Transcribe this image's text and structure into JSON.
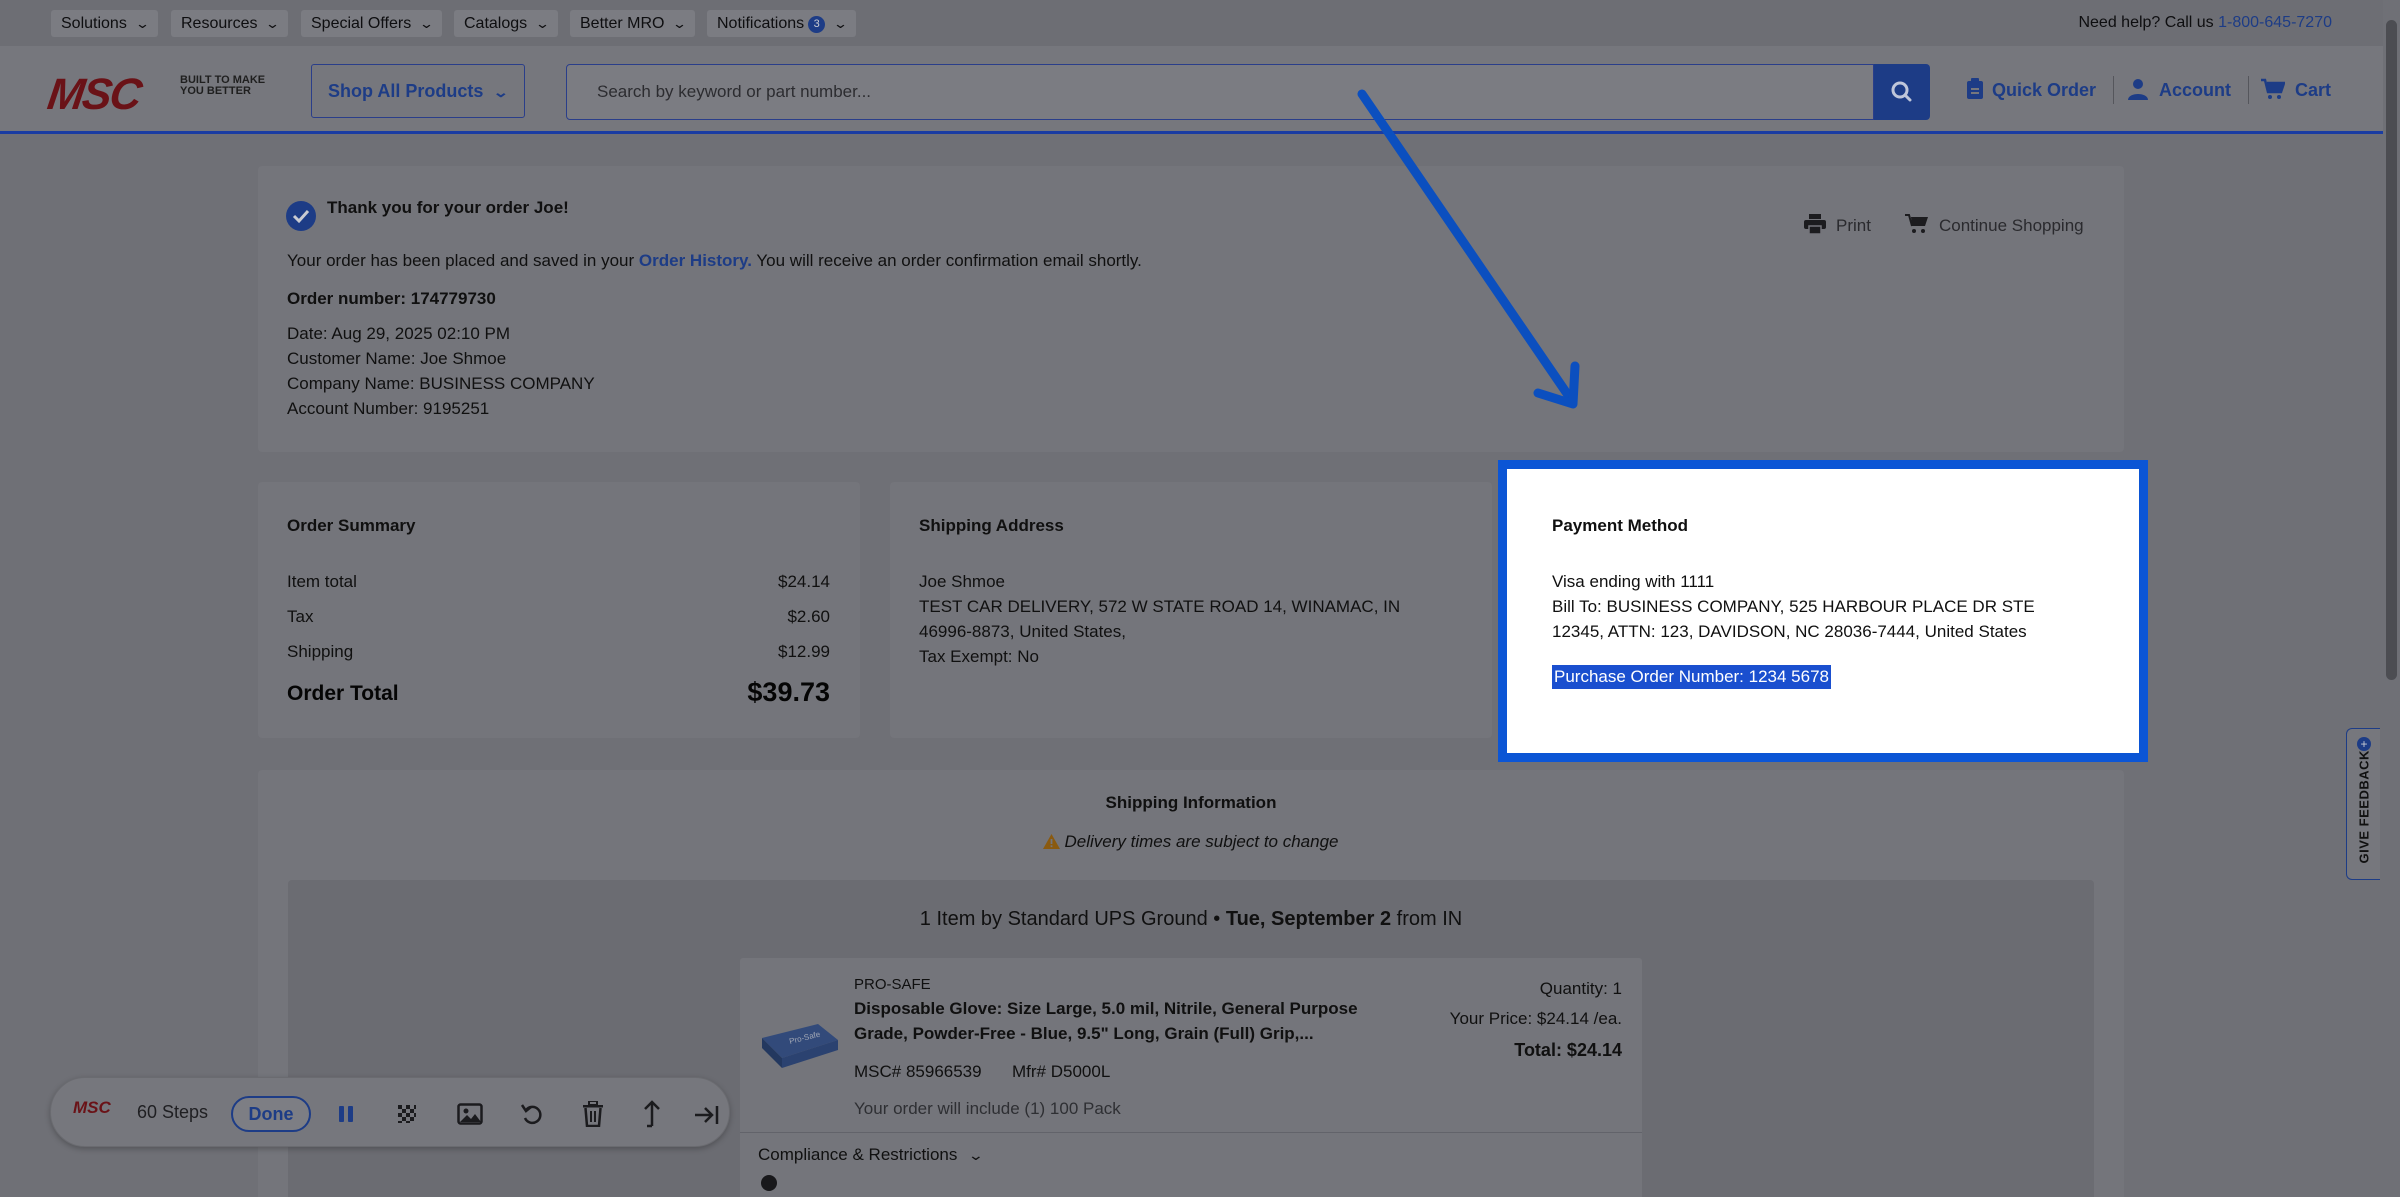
{
  "utility_nav": {
    "items": [
      {
        "label": "Solutions"
      },
      {
        "label": "Resources"
      },
      {
        "label": "Special Offers"
      },
      {
        "label": "Catalogs"
      },
      {
        "label": "Better MRO"
      },
      {
        "label": "Notifications",
        "badge": "3"
      }
    ],
    "help_text": "Need help? Call us",
    "help_phone": "1-800-645-7270"
  },
  "header": {
    "logo": "MSC",
    "logo_tagline": "BUILT TO MAKE YOU BETTER",
    "shop_all_label": "Shop All Products",
    "search_placeholder": "Search by keyword or part number...",
    "quick_order_label": "Quick Order",
    "account_label": "Account",
    "cart_label": "Cart",
    "brand_color": "#1d3c86"
  },
  "confirmation": {
    "title": "Thank you for your order Joe!",
    "message_before": "Your order has been placed and saved in your",
    "order_history_link": "Order History.",
    "message_after": "You will receive an order confirmation email shortly.",
    "order_number": "Order number: 174779730",
    "date": "Date: Aug 29, 2025 02:10 PM",
    "customer_name": "Customer Name: Joe Shmoe",
    "company_name": "Company Name: BUSINESS COMPANY",
    "account_number": "Account Number: 9195251",
    "print_label": "Print",
    "continue_label": "Continue Shopping"
  },
  "order_summary": {
    "title": "Order Summary",
    "lines": [
      {
        "label": "Item total",
        "value": "$24.14"
      },
      {
        "label": "Tax",
        "value": "$2.60"
      },
      {
        "label": "Shipping",
        "value": "$12.99"
      }
    ],
    "total_label": "Order Total",
    "total_value": "$39.73"
  },
  "shipping_address": {
    "title": "Shipping Address",
    "name": "Joe Shmoe",
    "line1": "TEST CAR DELIVERY, 572 W STATE ROAD 14, WINAMAC, IN",
    "line2": "46996-8873, United States,",
    "tax_exempt": "Tax Exempt: No"
  },
  "payment_method": {
    "title": "Payment Method",
    "card": "Visa ending with 1111",
    "bill_to_1": "Bill To: BUSINESS COMPANY, 525 HARBOUR PLACE DR STE",
    "bill_to_2": "12345, ATTN: 123, DAVIDSON, NC 28036-7444, United States",
    "po_number": "Purchase Order Number: 1234 5678",
    "highlight_color": "#0b55d5"
  },
  "shipping_info": {
    "title": "Shipping Information",
    "notice": "Delivery times are subject to change",
    "method_prefix": "1 Item by Standard UPS Ground •",
    "method_date": "Tue, September 2",
    "method_suffix": "from IN"
  },
  "item": {
    "brand": "PRO-SAFE",
    "name_line1": "Disposable Glove: Size Large, 5.0 mil, Nitrile, General Purpose",
    "name_line2": "Grade, Powder-Free - Blue, 9.5\" Long, Grain (Full) Grip,...",
    "msc_number": "MSC# 85966539",
    "mfr_number": "Mfr# D5000L",
    "pack_note": "Your order will include (1) 100 Pack",
    "quantity": "Quantity: 1",
    "price": "Your Price: $24.14 /ea.",
    "total": "Total: $24.14",
    "compliance_label": "Compliance & Restrictions"
  },
  "recorder_toolbar": {
    "logo": "MSC",
    "steps": "60 Steps",
    "done_label": "Done"
  },
  "feedback_tab": "GIVE FEEDBACK"
}
